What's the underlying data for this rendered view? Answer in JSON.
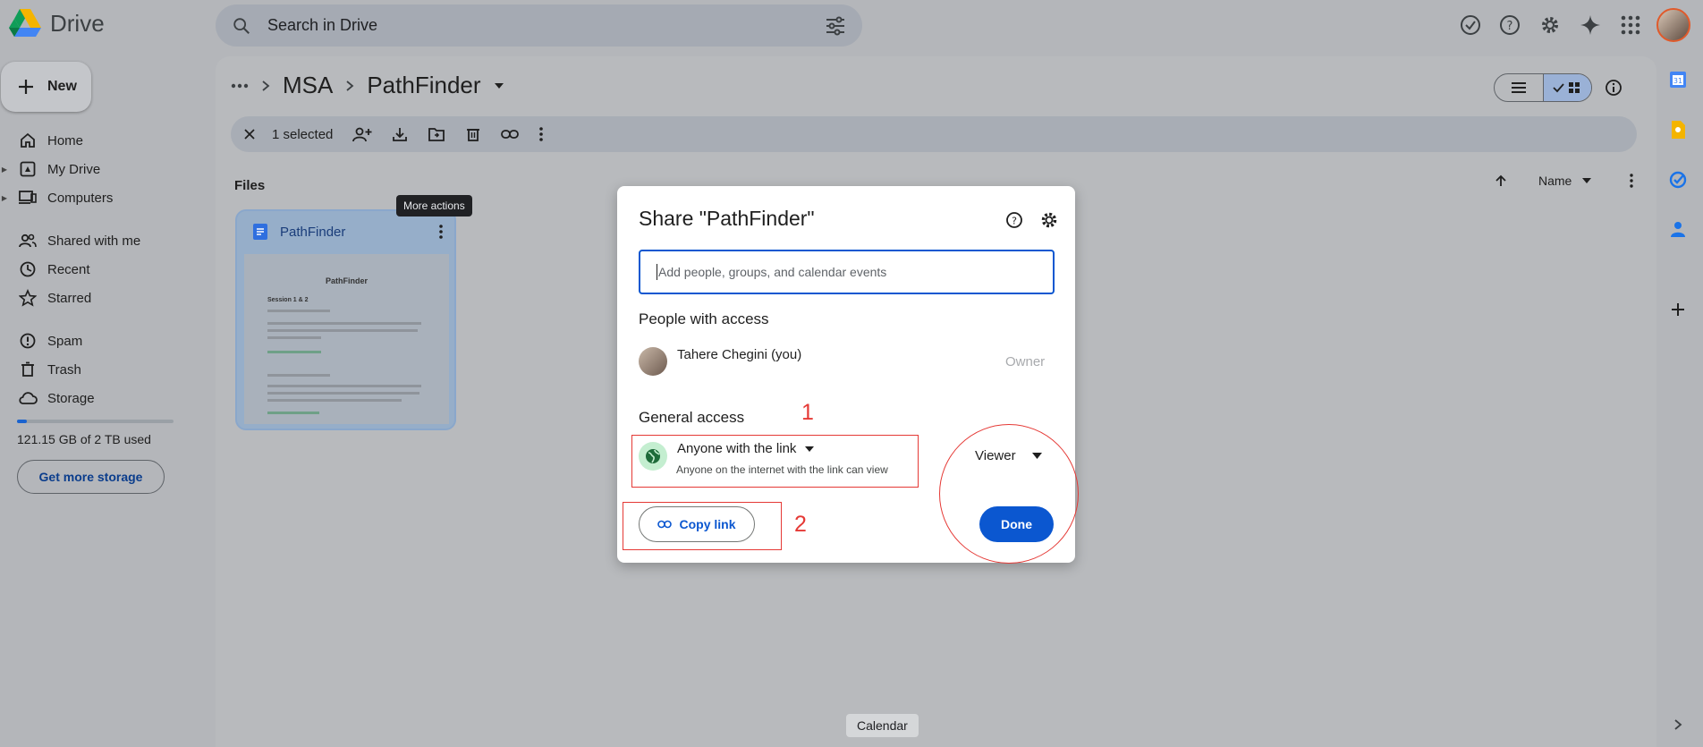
{
  "app": {
    "name": "Drive"
  },
  "search": {
    "placeholder": "Search in Drive"
  },
  "sidebar": {
    "new_label": "New",
    "items": [
      {
        "label": "Home",
        "icon": "home-icon"
      },
      {
        "label": "My Drive",
        "icon": "my-drive-icon"
      },
      {
        "label": "Computers",
        "icon": "computers-icon"
      },
      {
        "label": "Shared with me",
        "icon": "shared-icon"
      },
      {
        "label": "Recent",
        "icon": "clock-icon"
      },
      {
        "label": "Starred",
        "icon": "star-icon"
      },
      {
        "label": "Spam",
        "icon": "spam-icon"
      },
      {
        "label": "Trash",
        "icon": "trash-icon"
      },
      {
        "label": "Storage",
        "icon": "cloud-icon"
      }
    ],
    "storage": {
      "used_text": "121.15 GB of 2 TB used",
      "used_fraction": 0.06,
      "button": "Get more storage"
    }
  },
  "breadcrumb": {
    "parent": "MSA",
    "current": "PathFinder"
  },
  "toolbar": {
    "selected_text": "1 selected"
  },
  "files": {
    "heading": "Files",
    "sort_label": "Name",
    "card": {
      "name": "PathFinder",
      "thumb_title": "PathFinder",
      "thumb_subtitle": "Session 1 & 2"
    }
  },
  "tooltips": {
    "more_actions": "More actions",
    "calendar": "Calendar"
  },
  "dialog": {
    "title": "Share \"PathFinder\"",
    "input_placeholder": "Add people, groups, and calendar events",
    "people_heading": "People with access",
    "owner_name": "Tahere Chegini (you)",
    "owner_role": "Owner",
    "general_heading": "General access",
    "access_type": "Anyone with the link",
    "access_desc": "Anyone on the internet with the link can view",
    "role": "Viewer",
    "copy_link": "Copy link",
    "done": "Done",
    "annotations": {
      "one": "1",
      "two": "2"
    }
  },
  "colors": {
    "accent": "#0b57d0",
    "annotation": "#e53935"
  }
}
